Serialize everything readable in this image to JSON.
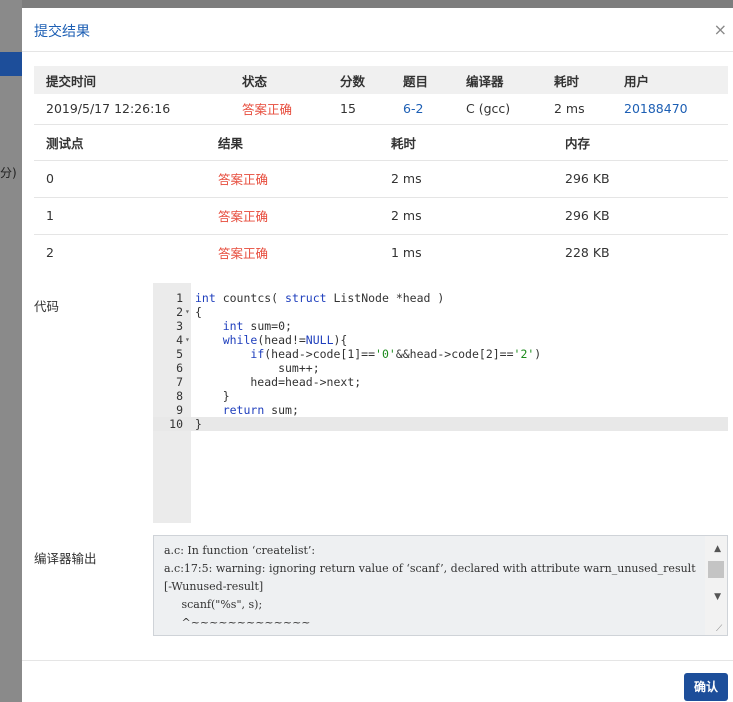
{
  "modal": {
    "title": "提交结果",
    "close": "×",
    "confirm_label": "确认"
  },
  "background": {
    "fragment": "分)"
  },
  "submission": {
    "headers": [
      "提交时间",
      "状态",
      "分数",
      "题目",
      "编译器",
      "耗时",
      "用户"
    ],
    "row": {
      "time": "2019/5/17 12:26:16",
      "status": "答案正确",
      "score": "15",
      "problem": "6-2",
      "compiler": "C (gcc)",
      "elapsed": "2 ms",
      "user": "20188470"
    }
  },
  "testcases": {
    "headers": [
      "测试点",
      "结果",
      "耗时",
      "内存"
    ],
    "rows": [
      {
        "id": "0",
        "result": "答案正确",
        "time": "2 ms",
        "memory": "296 KB"
      },
      {
        "id": "1",
        "result": "答案正确",
        "time": "2 ms",
        "memory": "296 KB"
      },
      {
        "id": "2",
        "result": "答案正确",
        "time": "1 ms",
        "memory": "228 KB"
      }
    ]
  },
  "code": {
    "label": "代码",
    "lines": [
      "int countcs( struct ListNode *head )",
      "{",
      "    int sum=0;",
      "    while(head!=NULL){",
      "        if(head->code[1]=='0'&&head->code[2]=='2')",
      "            sum++;",
      "        head=head->next;",
      "    }",
      "    return sum;",
      "}"
    ],
    "line_numbers": [
      "1",
      "2",
      "3",
      "4",
      "5",
      "6",
      "7",
      "8",
      "9",
      "10"
    ]
  },
  "compiler_output": {
    "label": "编译器输出",
    "text": "a.c: In function ‘createlist’:\na.c:17:5: warning: ignoring return value of ‘scanf’, declared with attribute warn_unused_result [-Wunused-result]\n     scanf(\"%s\", s);\n     ^~~~~~~~~~~~~~"
  }
}
